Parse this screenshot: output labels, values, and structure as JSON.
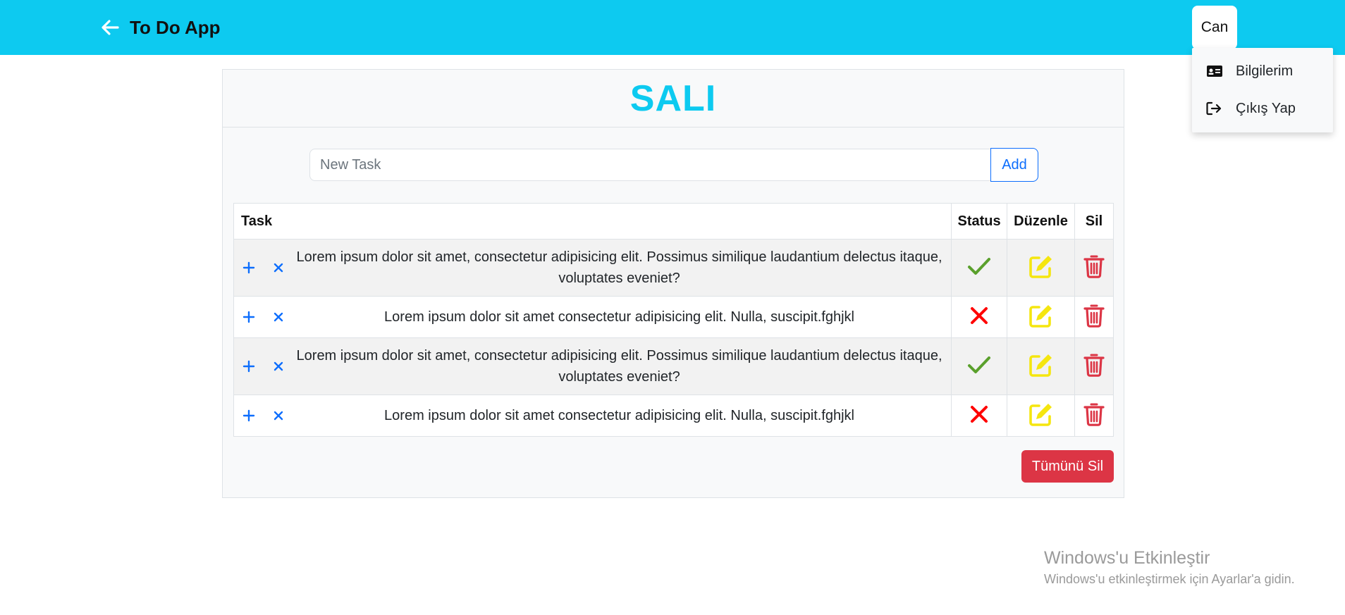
{
  "navbar": {
    "title": "To Do App",
    "back_icon": "arrow-left-icon",
    "user_name": "Can",
    "bg_color": "#0dcaf0"
  },
  "user_menu": {
    "items": [
      {
        "label": "Bilgilerim",
        "icon": "id-card-icon"
      },
      {
        "label": "Çıkış Yap",
        "icon": "sign-out-icon"
      }
    ]
  },
  "page": {
    "day_title": "SALI",
    "new_task_placeholder": "New Task",
    "add_button": "Add",
    "delete_all_button": "Tümünü Sil"
  },
  "table": {
    "headers": {
      "task": "Task",
      "status": "Status",
      "edit": "Düzenle",
      "delete": "Sil"
    },
    "rows": [
      {
        "text": "Lorem ipsum dolor sit amet, consectetur adipisicing elit. Possimus similique laudantium delectus itaque, voluptates eveniet?",
        "done": true
      },
      {
        "text": "Lorem ipsum dolor sit amet consectetur adipisicing elit. Nulla, suscipit.fghjkl",
        "done": false
      },
      {
        "text": "Lorem ipsum dolor sit amet, consectetur adipisicing elit. Possimus similique laudantium delectus itaque, voluptates eveniet?",
        "done": true
      },
      {
        "text": "Lorem ipsum dolor sit amet consectetur adipisicing elit. Nulla, suscipit.fghjkl",
        "done": false
      }
    ]
  },
  "colors": {
    "accent": "#0dcaf0",
    "primary": "#0d6efd",
    "done": "#5aa02c",
    "not_done": "#ff0000",
    "edit": "#f5e60f",
    "delete": "#dc3545"
  },
  "watermark": {
    "title": "Windows'u Etkinleştir",
    "subtitle": "Windows'u etkinleştirmek için Ayarlar'a gidin."
  }
}
